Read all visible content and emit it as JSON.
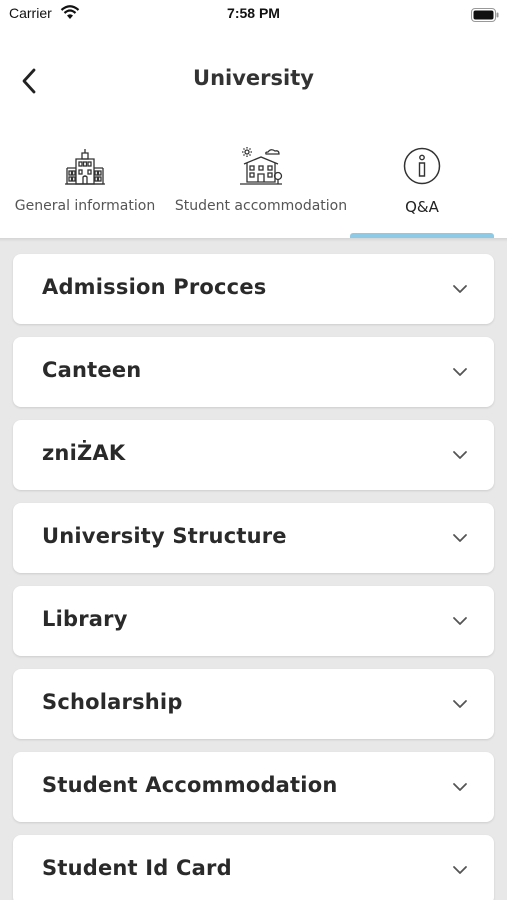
{
  "status_bar": {
    "carrier": "Carrier",
    "time": "7:58 PM"
  },
  "nav": {
    "title": "University"
  },
  "tabs": [
    {
      "label": "General information",
      "icon": "university-building-icon"
    },
    {
      "label": "Student accommodation",
      "icon": "dormitory-building-icon"
    },
    {
      "label": "Q&A",
      "icon": "info-circle-icon",
      "selected": true
    }
  ],
  "colors": {
    "tab_indicator": "#8ecae6",
    "background": "#e8e8e8",
    "card": "#ffffff"
  },
  "qa_sections": [
    {
      "title": "Admission Procces"
    },
    {
      "title": "Canteen"
    },
    {
      "title": "zniŻAK"
    },
    {
      "title": "University Structure"
    },
    {
      "title": "Library"
    },
    {
      "title": "Scholarship"
    },
    {
      "title": "Student Accommodation"
    },
    {
      "title": "Student Id Card"
    }
  ]
}
